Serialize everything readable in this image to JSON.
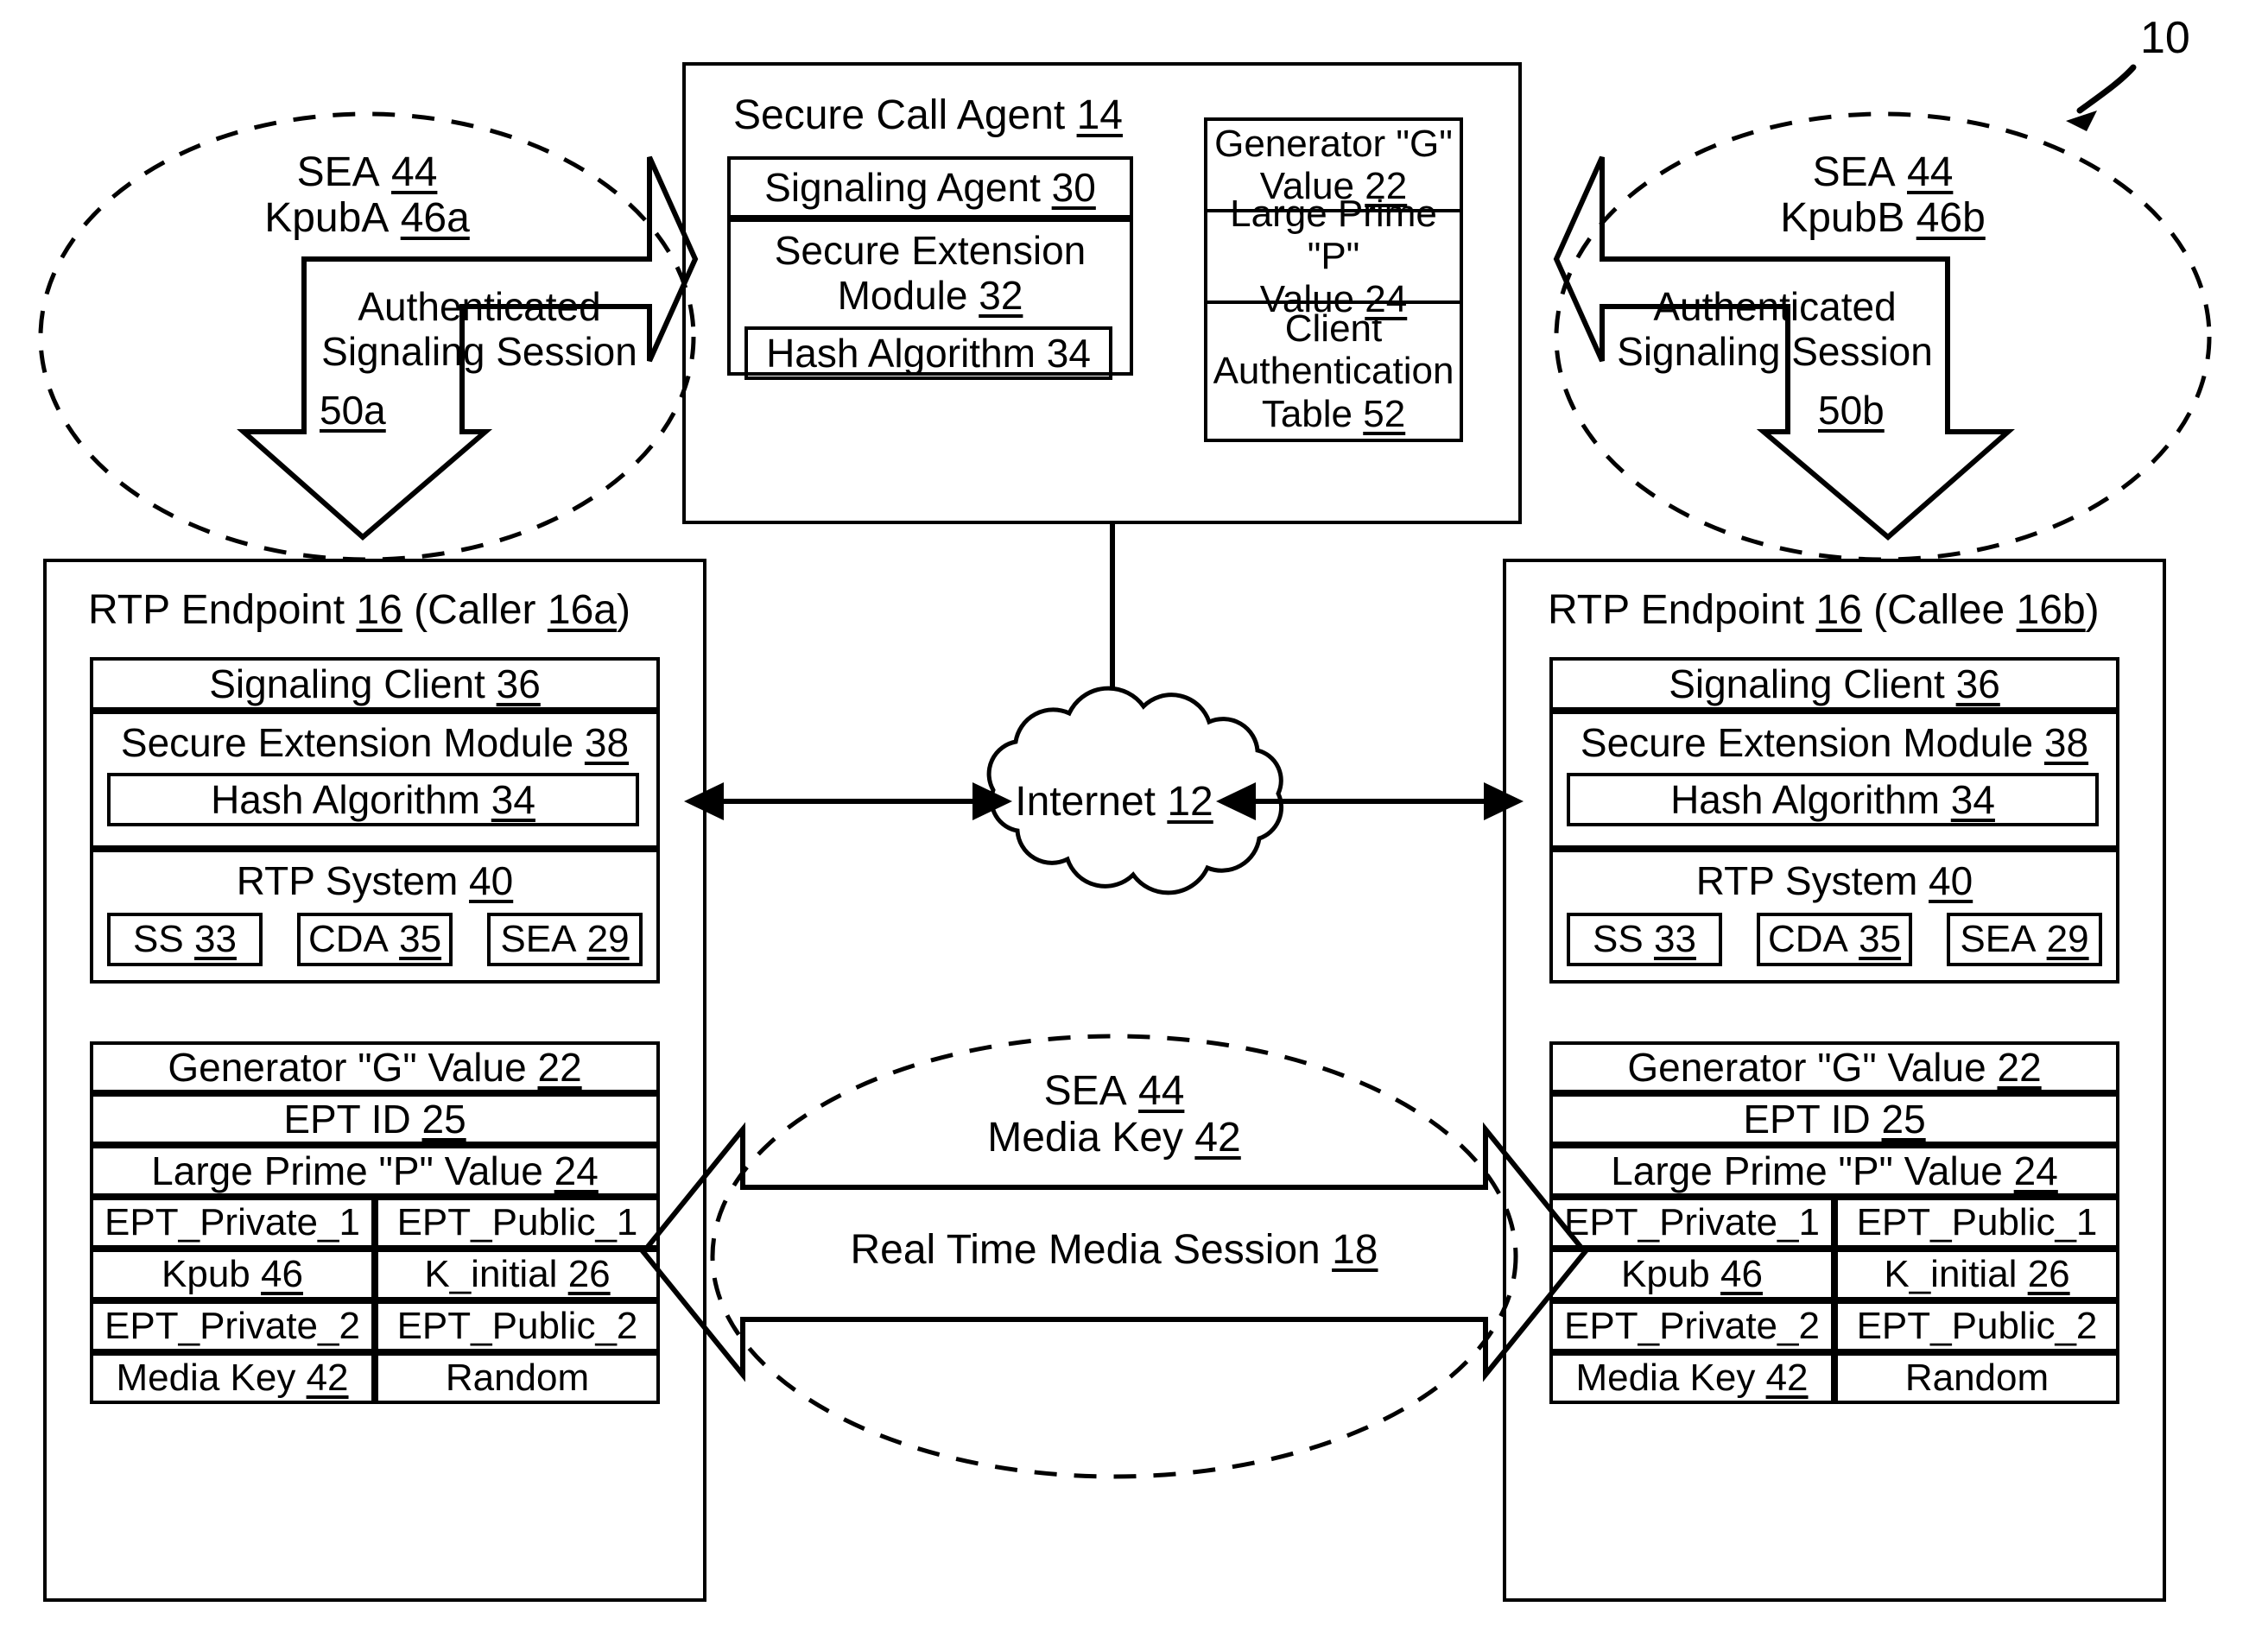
{
  "figure": {
    "reference_numeral": "10"
  },
  "left_ellipse": {
    "line1": "SEA",
    "line1_num": "44",
    "line2": "KpubA",
    "line2_num": "46a",
    "arrow_label_l1": "Authenticated",
    "arrow_label_l2": "Signaling Session",
    "arrow_label_num": "50a"
  },
  "right_ellipse": {
    "line1": "SEA",
    "line1_num": "44",
    "line2": "KpubB",
    "line2_num": "46b",
    "arrow_label_l1": "Authenticated",
    "arrow_label_l2": "Signaling Session",
    "arrow_label_num": "50b"
  },
  "center_ellipse": {
    "line1": "SEA",
    "line1_num": "44",
    "line2": "Media Key",
    "line2_num": "42",
    "arrow_label": "Real Time Media Session",
    "arrow_label_num": "18"
  },
  "secure_call_agent": {
    "title": "Secure Call Agent",
    "title_num": "14",
    "signaling_agent": "Signaling Agent",
    "signaling_agent_num": "30",
    "secure_extension_module_l1": "Secure Extension",
    "secure_extension_module_l2": "Module",
    "secure_extension_module_num": "32",
    "hash_algorithm": "Hash Algorithm",
    "hash_algorithm_num": "34",
    "right_stack": [
      {
        "l1": "Generator \"G\"",
        "l2": "Value",
        "num": "22"
      },
      {
        "l1": "Large Prime \"P\"",
        "l2": "Value",
        "num": "24"
      },
      {
        "l1": "Client",
        "l2": "Authentication",
        "l3": "Table",
        "num": "52"
      }
    ]
  },
  "internet": {
    "label": "Internet",
    "label_num": "12"
  },
  "endpoints": [
    {
      "side": "left",
      "title": "RTP Endpoint",
      "title_num": "16",
      "title_paren_pre": "(Caller",
      "title_paren_num": "16a",
      "title_paren_post": ")",
      "signaling_client": "Signaling Client",
      "signaling_client_num": "36",
      "secure_extension_module": "Secure Extension Module",
      "secure_extension_module_num": "38",
      "hash_algorithm": "Hash Algorithm",
      "hash_algorithm_num": "34",
      "rtp_system": "RTP System",
      "rtp_system_num": "40",
      "rtp_chips": [
        {
          "label": "SS",
          "num": "33"
        },
        {
          "label": "CDA",
          "num": "35"
        },
        {
          "label": "SEA",
          "num": "29"
        }
      ],
      "table_full_rows": [
        {
          "label": "Generator \"G\" Value",
          "num": "22"
        },
        {
          "label": "EPT ID",
          "num": "25"
        },
        {
          "label": "Large Prime \"P\" Value",
          "num": "24"
        }
      ],
      "table_pair_rows": [
        {
          "left": "EPT_Private_1",
          "left_num": "",
          "right": "EPT_Public_1",
          "right_num": ""
        },
        {
          "left": "Kpub",
          "left_num": "46",
          "right": "K_initial",
          "right_num": "26"
        },
        {
          "left": "EPT_Private_2",
          "left_num": "",
          "right": "EPT_Public_2",
          "right_num": ""
        },
        {
          "left": "Media Key",
          "left_num": "42",
          "right": "Random",
          "right_num": ""
        }
      ]
    },
    {
      "side": "right",
      "title": "RTP Endpoint",
      "title_num": "16",
      "title_paren_pre": "(Callee",
      "title_paren_num": "16b",
      "title_paren_post": ")",
      "signaling_client": "Signaling Client",
      "signaling_client_num": "36",
      "secure_extension_module": "Secure Extension Module",
      "secure_extension_module_num": "38",
      "hash_algorithm": "Hash Algorithm",
      "hash_algorithm_num": "34",
      "rtp_system": "RTP System",
      "rtp_system_num": "40",
      "rtp_chips": [
        {
          "label": "SS",
          "num": "33"
        },
        {
          "label": "CDA",
          "num": "35"
        },
        {
          "label": "SEA",
          "num": "29"
        }
      ],
      "table_full_rows": [
        {
          "label": "Generator \"G\" Value",
          "num": "22"
        },
        {
          "label": "EPT ID",
          "num": "25"
        },
        {
          "label": "Large Prime \"P\" Value",
          "num": "24"
        }
      ],
      "table_pair_rows": [
        {
          "left": "EPT_Private_1",
          "left_num": "",
          "right": "EPT_Public_1",
          "right_num": ""
        },
        {
          "left": "Kpub",
          "left_num": "46",
          "right": "K_initial",
          "right_num": "26"
        },
        {
          "left": "EPT_Private_2",
          "left_num": "",
          "right": "EPT_Public_2",
          "right_num": ""
        },
        {
          "left": "Media Key",
          "left_num": "42",
          "right": "Random",
          "right_num": ""
        }
      ]
    }
  ],
  "colors": {
    "ink": "#000000",
    "paper": "#ffffff"
  }
}
